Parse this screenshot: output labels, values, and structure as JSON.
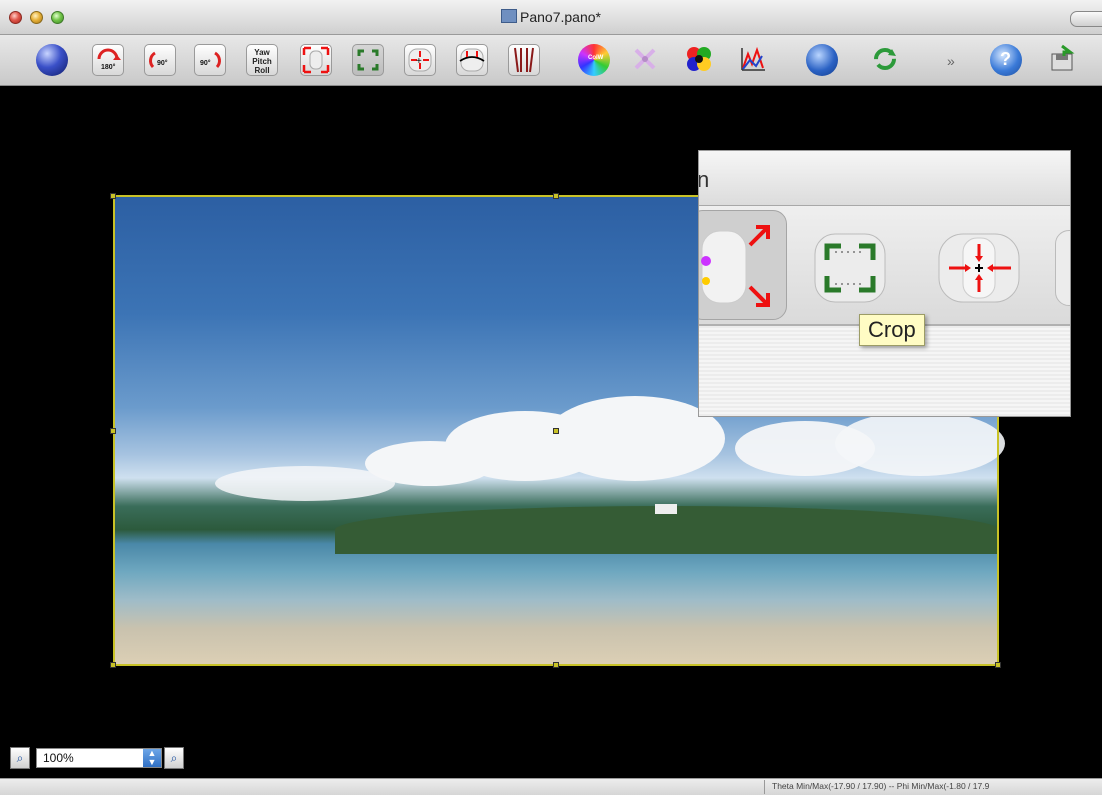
{
  "window": {
    "title": "Pano7.pano*"
  },
  "toolbar": {
    "buttons": [
      {
        "name": "globe-preview-icon",
        "label": ""
      },
      {
        "name": "rotate-180-button",
        "label": "180°"
      },
      {
        "name": "rotate-ccw-90-button",
        "label": "90°"
      },
      {
        "name": "rotate-cw-90-button",
        "label": "90°"
      },
      {
        "name": "yaw-pitch-roll-button",
        "label": "Yaw Pitch Roll"
      },
      {
        "name": "fit-panorama-button",
        "label": ""
      },
      {
        "name": "crop-button",
        "label": ""
      },
      {
        "name": "center-panorama-button",
        "label": ""
      },
      {
        "name": "straighten-button",
        "label": ""
      },
      {
        "name": "vertical-lines-button",
        "label": ""
      },
      {
        "name": "color-wheel-button",
        "label": "ColW"
      },
      {
        "name": "control-points-button",
        "label": ""
      },
      {
        "name": "layers-button",
        "label": ""
      },
      {
        "name": "histogram-button",
        "label": ""
      },
      {
        "name": "stitch-button",
        "label": ""
      },
      {
        "name": "refresh-button",
        "label": ""
      },
      {
        "name": "help-button",
        "label": ""
      },
      {
        "name": "export-button",
        "label": ""
      }
    ],
    "overflow_label": "»"
  },
  "zoom_overlay": {
    "title_fragment": "n",
    "tooltip": "Crop"
  },
  "zoom_control": {
    "value": "100%"
  },
  "status": {
    "text": "Theta Min/Max(-17.90 / 17.90) -- Phi Min/Max(-1.80 / 17.9"
  },
  "colors": {
    "crop_frame": "#c8c227",
    "accent_blue": "#2f6fc4"
  }
}
